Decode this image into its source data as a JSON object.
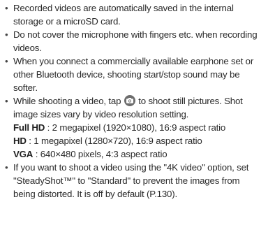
{
  "notes": [
    "Recorded videos are automatically saved in the internal storage or a microSD card.",
    "Do not cover the microphone with fingers etc. when recording videos.",
    "When you connect a commercially available earphone set or other Bluetooth device, shooting start/stop sound may be softer."
  ],
  "still_shot": {
    "before_icon": "While shooting a video, tap",
    "icon": "camera-shutter-icon",
    "after_icon": "to shoot still pictures. Shot image sizes vary by video resolution setting.",
    "specs": [
      {
        "label": "Full HD",
        "value": " : 2 megapixel (1920×1080), 16:9 aspect ratio"
      },
      {
        "label": "HD",
        "value": " : 1 megapixel (1280×720), 16:9 aspect ratio"
      },
      {
        "label": "VGA",
        "value": " : 640×480 pixels, 4:3 aspect ratio"
      }
    ]
  },
  "steadyshot_note": "If you want to shoot a video using the \"4K video\" option, set \"SteadyShot™\" to \"Standard\" to prevent the images from being distorted. It is off by default (P.130)."
}
